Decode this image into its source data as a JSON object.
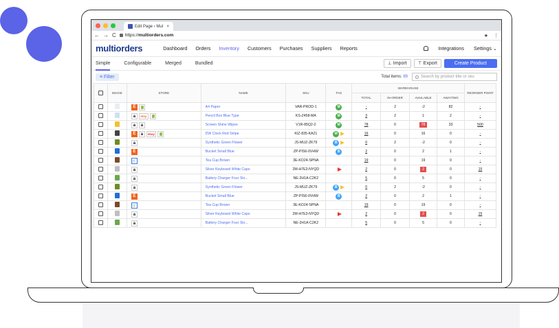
{
  "browser": {
    "tab_title": "Edit Page ‹ Mul",
    "tab_close": "×",
    "url_prefix": "https://",
    "url_host": "multiorders.com",
    "nav_back": "←",
    "nav_forward": "→",
    "nav_reload": "C",
    "star": "★",
    "menu": "⋮"
  },
  "app": {
    "logo": "multiorders",
    "nav": [
      "Dashboard",
      "Orders",
      "Inventory",
      "Customers",
      "Purchases",
      "Suppliers",
      "Reports"
    ],
    "active_nav": "Inventory",
    "integrations": "Integrations",
    "settings": "Settings ⌄"
  },
  "subtabs": [
    "Simple",
    "Configurable",
    "Merged",
    "Bundled"
  ],
  "actions": {
    "import": "⊥ Import",
    "export": "⊤ Export",
    "create": "Create Product"
  },
  "filter": {
    "label": "≡ Filter",
    "total_label": "Total items:",
    "total_count": "89",
    "search_placeholder": "Search by product title or sku"
  },
  "table": {
    "headers": {
      "image": "IMAGE",
      "store": "STORE",
      "name": "NAME",
      "sku": "SKU",
      "tag": "TAG",
      "warehouse": "WAREHOUSE",
      "total": "TOTAL",
      "in_order": "IN-ORDER",
      "available": "AVAILABLE",
      "awaiting": "AWAITING",
      "reorder": "REORDER POINT"
    },
    "rows": [
      {
        "img": "#e9eef3",
        "stores": [
          "etsy",
          "shop"
        ],
        "name": "A4 Paper",
        "sku": "VAR-PROD-1",
        "tags": [
          "M"
        ],
        "flag": "",
        "total": "-",
        "in_order": "2",
        "available": "-2",
        "avail_neg": false,
        "awaiting": "82",
        "reorder": "-"
      },
      {
        "img": "#cfe0f2",
        "stores": [
          "amz",
          "etsy-text",
          "shop"
        ],
        "name": "Pencil Box Blue Type",
        "sku": "KS-Z458-MA",
        "tags": [
          "M"
        ],
        "flag": "",
        "total": "3",
        "in_order": "2",
        "available": "1",
        "avail_neg": false,
        "awaiting": "2",
        "reorder": "-"
      },
      {
        "img": "#f1c232",
        "stores": [
          "amz",
          "amz"
        ],
        "name": "Screen Shine Wipes",
        "sku": "V1R-85Q2-2",
        "tags": [
          "M"
        ],
        "flag": "",
        "total": "78",
        "in_order": "0",
        "available": "78",
        "avail_neg": true,
        "awaiting": "33",
        "reorder": "500"
      },
      {
        "img": "#444444",
        "stores": [
          "etsy",
          "amz",
          "ebay",
          "shop"
        ],
        "name": "DW Clock Red Stripe",
        "sku": "KIZ-835-KA21",
        "tags": [
          "M"
        ],
        "flag": "yellow",
        "total": "16",
        "in_order": "0",
        "available": "16",
        "avail_neg": false,
        "awaiting": "0",
        "reorder": "-"
      },
      {
        "img": "#6b8e23",
        "stores": [
          "amz"
        ],
        "name": "Synthetic Green Flower",
        "sku": "JS-MUZ-ZK79",
        "tags": [
          "B"
        ],
        "flag": "yellow",
        "total": "0",
        "in_order": "2",
        "available": "-2",
        "avail_neg": false,
        "awaiting": "0",
        "reorder": "-"
      },
      {
        "img": "#1e6fd9",
        "stores": [
          "etsy"
        ],
        "name": "Bucket Small Blue",
        "sku": "ZP-PIS6-0VHW",
        "tags": [
          "B"
        ],
        "flag": "",
        "total": "2",
        "in_order": "0",
        "available": "2",
        "avail_neg": false,
        "awaiting": "1",
        "reorder": "-"
      },
      {
        "img": "#7a4a2a",
        "stores": [
          "cart"
        ],
        "name": "Tea Cup Brown",
        "sku": "3E-KO24-SPNA",
        "tags": [],
        "flag": "",
        "total": "19",
        "in_order": "0",
        "available": "19",
        "avail_neg": false,
        "awaiting": "0",
        "reorder": "-"
      },
      {
        "img": "#bfbfbf",
        "stores": [
          "amz"
        ],
        "name": "Silver Keyboard White Caps",
        "sku": "2M-H7E3-NYQD",
        "tags": [],
        "flag": "red",
        "total": "2",
        "in_order": "0",
        "available": "2",
        "avail_neg": true,
        "awaiting": "0",
        "reorder": "15"
      },
      {
        "img": "#6aa84f",
        "stores": [
          "amz"
        ],
        "name": "Battery Charger Four Slo...",
        "sku": "NE-2H1A-C2K2",
        "tags": [],
        "flag": "",
        "total": "5",
        "in_order": "0",
        "available": "5",
        "avail_neg": false,
        "awaiting": "0",
        "reorder": "-"
      },
      {
        "img": "#6b8e23",
        "stores": [
          "amz"
        ],
        "name": "Synthetic Green Flower",
        "sku": "JS-MUZ-ZK79",
        "tags": [
          "B"
        ],
        "flag": "yellow",
        "total": "0",
        "in_order": "2",
        "available": "-2",
        "avail_neg": false,
        "awaiting": "0",
        "reorder": "-"
      },
      {
        "img": "#1e6fd9",
        "stores": [
          "etsy"
        ],
        "name": "Bucket Small Blue",
        "sku": "ZP-PIS6-0VHW",
        "tags": [
          "B"
        ],
        "flag": "",
        "total": "2",
        "in_order": "0",
        "available": "2",
        "avail_neg": false,
        "awaiting": "1",
        "reorder": "-"
      },
      {
        "img": "#7a4a2a",
        "stores": [
          "cart"
        ],
        "name": "Tea Cup Brown",
        "sku": "3E-KO24-SPNA",
        "tags": [],
        "flag": "",
        "total": "19",
        "in_order": "0",
        "available": "19",
        "avail_neg": false,
        "awaiting": "0",
        "reorder": "-"
      },
      {
        "img": "#bfbfbf",
        "stores": [
          "amz"
        ],
        "name": "Silver Keyboard White Caps",
        "sku": "2M-H7E3-NYQD",
        "tags": [],
        "flag": "red",
        "total": "2",
        "in_order": "0",
        "available": "2",
        "avail_neg": true,
        "awaiting": "0",
        "reorder": "15"
      },
      {
        "img": "#6aa84f",
        "stores": [
          "amz"
        ],
        "name": "Battery Charger Four Slo...",
        "sku": "NE-2H1A-C2K2",
        "tags": [],
        "flag": "",
        "total": "5",
        "in_order": "0",
        "available": "5",
        "avail_neg": false,
        "awaiting": "0",
        "reorder": "-"
      }
    ]
  },
  "colors": {
    "accent": "#5b63e6",
    "primary_button": "#4b6df2",
    "logo": "#1f3b8c",
    "negative": "#e05050",
    "tag_m": "#4caf50",
    "tag_b": "#42a5f5"
  }
}
